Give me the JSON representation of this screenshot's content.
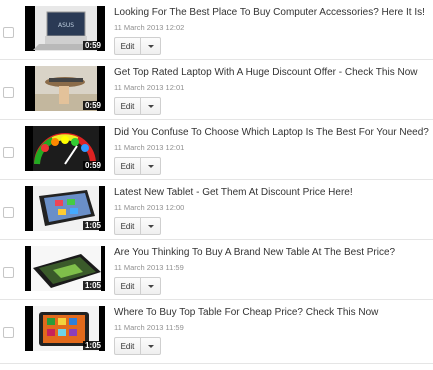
{
  "videos": [
    {
      "title": "Looking For The Best Place To Buy Computer Accessories? Here It Is!",
      "date": "11 March 2013 12:02",
      "duration": "0:59",
      "edit_label": "Edit",
      "thumb_icon": "laptop-thumbnail-icon"
    },
    {
      "title": "Get Top Rated Laptop With A Huge Discount Offer - Check This Now",
      "date": "11 March 2013 12:01",
      "duration": "0:59",
      "edit_label": "Edit",
      "thumb_icon": "hand-laptop-thumbnail-icon"
    },
    {
      "title": "Did You Confuse To Choose Which Laptop Is The Best For Your Need?",
      "date": "11 March 2013 12:01",
      "duration": "0:59",
      "edit_label": "Edit",
      "thumb_icon": "gauge-thumbnail-icon"
    },
    {
      "title": "Latest New Tablet - Get Them At Discount Price Here!",
      "date": "11 March 2013 12:00",
      "duration": "1:05",
      "edit_label": "Edit",
      "thumb_icon": "tablet-thumbnail-icon"
    },
    {
      "title": "Are You Thinking To Buy A Brand New Table At The Best Price?",
      "date": "11 March 2013 11:59",
      "duration": "1:05",
      "edit_label": "Edit",
      "thumb_icon": "tablet-tilted-thumbnail-icon"
    },
    {
      "title": "Where To Buy Top Table For Cheap Price? Check This Now",
      "date": "11 March 2013 11:59",
      "duration": "1:05",
      "edit_label": "Edit",
      "thumb_icon": "tablet-color-thumbnail-icon"
    }
  ]
}
